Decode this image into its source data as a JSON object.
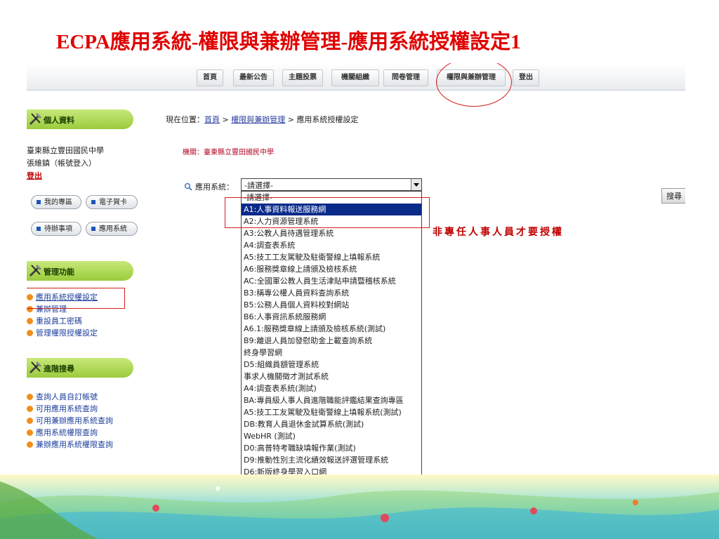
{
  "slide": {
    "title": "ECPA應用系統-權限與兼辦管理-應用系統授權設定1",
    "annotation": "非專任人事人員才要授權"
  },
  "topnav": {
    "items": [
      {
        "label": "首頁"
      },
      {
        "label": "最新公告"
      },
      {
        "label": "主題投票"
      },
      {
        "label": "機關組織"
      },
      {
        "label": "問卷管理"
      },
      {
        "label": "權限與兼辦管理"
      },
      {
        "label": "登出"
      }
    ]
  },
  "sidebar": {
    "personal": {
      "header": "個人資料",
      "org": "臺東縣立豐田國民中學",
      "user": "張維鎮（帳號登入）",
      "logout": "登出",
      "buttons": [
        "我的專區",
        "電子賀卡",
        "待辦事項",
        "應用系統"
      ]
    },
    "manage": {
      "header": "管理功能",
      "items": [
        "應用系統授權設定",
        "兼辦管理",
        "重設員工密碼",
        "管理權限授權設定"
      ]
    },
    "advanced": {
      "header": "進階搜尋",
      "items": [
        "查詢人員自訂帳號",
        "可用應用系統查詢",
        "可用兼辦應用系統查詢",
        "應用系統權限查詢",
        "兼辦應用系統權限查詢"
      ]
    }
  },
  "main": {
    "breadcrumb": {
      "prefix": "現在位置：",
      "home": "首頁",
      "sep1": " > ",
      "section": "權限與兼辦管理",
      "sep2": " > ",
      "current": "應用系統授權設定"
    },
    "org": "機關：臺東縣立豐田國民中學",
    "filter_label": "應用系統：",
    "select_value": "-請選擇-",
    "search_button": "搜尋",
    "options": [
      "-請選擇-",
      "A1:人事資料報送服務網",
      "A2:人力資源管理系統",
      "A3:公教人員待遇管理系統",
      "A4:調查表系統",
      "A5:技工工友駕駛及駐衛警線上填報系統",
      "A6:服務獎章線上請頒及檢核系統",
      "AC:全國軍公教人員生活津貼申請暨稽核系統",
      "B3:稱專公權人員資料查詢系統",
      "B5:公務人員個人資料校對網站",
      "B6:人事資訊系統服務網",
      "A6.1:服務獎章線上請頒及檢核系統(測試)",
      "B9:離退人員加發慰助金上載查詢系統",
      "終身學習網",
      "D5:組織員額管理系統",
      "事求人機關徵才測試系統",
      "A4:調查表系統(測試)",
      "BA:專員級人事人員進階職能評鑑結果查詢專區",
      "A5:技工工友駕駛及駐衛警線上填報系統(測試)",
      "DB:教育人員退休金試算系統(測試)",
      "WebHR (測試)",
      "D0:高普特考職缺填報作業(測試)",
      "D9:推動性別主流化績效報送評選管理系統",
      "D6:新版終身學習入口網"
    ],
    "selected_index": 1
  },
  "colors": {
    "title_red": "#e00000",
    "annotation_red": "#c00000",
    "highlight_red": "#d61e1e",
    "selected_bg": "#0a2a8a",
    "sidebar_green": "#9acb3c"
  }
}
